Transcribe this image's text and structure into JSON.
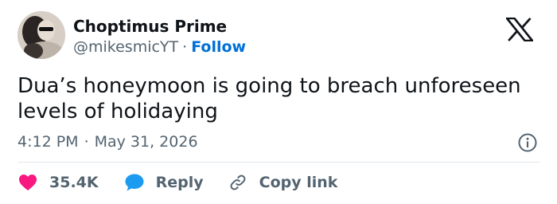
{
  "author": {
    "display_name": "Choptimus Prime",
    "handle": "@mikesmicYT",
    "separator": "·",
    "follow_label": "Follow"
  },
  "tweet": {
    "text": "Dua’s honeymoon is going to breach unforeseen levels of holidaying",
    "time": "4:12 PM",
    "separator": "·",
    "date": "May 31, 2026"
  },
  "actions": {
    "likes_count": "35.4K",
    "reply_label": "Reply",
    "copy_link_label": "Copy link"
  },
  "icons": {
    "brand": "x-logo-icon",
    "info": "info-icon",
    "like": "heart-icon",
    "reply": "speech-bubble-icon",
    "copy": "link-icon"
  },
  "colors": {
    "like": "#f91880",
    "reply": "#1d9bf0",
    "follow": "#006fd6",
    "secondary_text": "#536471",
    "primary_text": "#0f1419"
  }
}
